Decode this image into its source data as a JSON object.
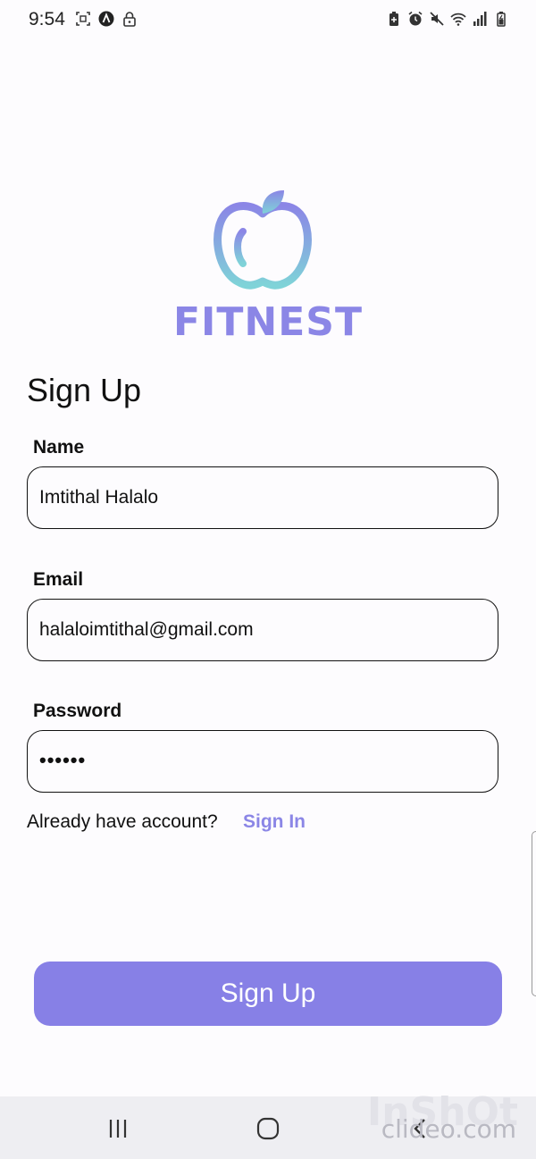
{
  "status_bar": {
    "time": "9:54",
    "left_icons": [
      "screenshot-icon",
      "app-a-icon",
      "lock-icon"
    ],
    "right_icons": [
      "battery-saver-icon",
      "alarm-icon",
      "mute-icon",
      "wifi-icon",
      "signal-icon",
      "battery-icon"
    ]
  },
  "logo": {
    "brand_text": "FITNEST",
    "icon": "apple-icon",
    "gradient_top": "#8b86e6",
    "gradient_bottom": "#7fd3d8"
  },
  "form": {
    "title": "Sign Up",
    "name": {
      "label": "Name",
      "value": "Imtithal Halalo"
    },
    "email": {
      "label": "Email",
      "value": "halaloimtithal@gmail.com"
    },
    "password": {
      "label": "Password",
      "value": "••••••"
    }
  },
  "signin_prompt": {
    "text": "Already have account?",
    "link": "Sign In"
  },
  "submit_button": {
    "label": "Sign Up"
  },
  "colors": {
    "accent": "#8780e6",
    "link": "#8b86e6",
    "background": "#fdfcfe"
  },
  "nav_bar": {
    "buttons": [
      "recent-apps-icon",
      "home-icon",
      "back-icon"
    ]
  },
  "watermark": {
    "text": "clideo.com",
    "bg_text": "InShOt"
  }
}
